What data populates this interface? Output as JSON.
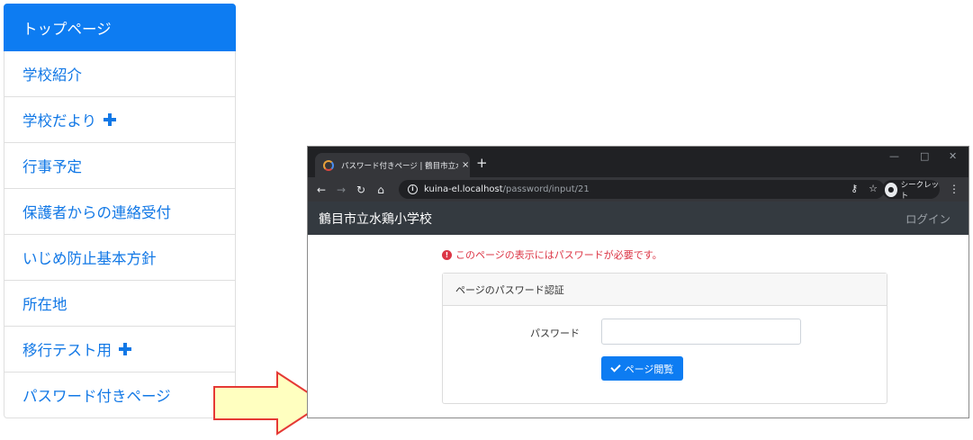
{
  "sidebar": {
    "items": [
      {
        "label": "トップページ",
        "active": true
      },
      {
        "label": "学校紹介"
      },
      {
        "label": "学校だより",
        "expandable": true
      },
      {
        "label": "行事予定"
      },
      {
        "label": "保護者からの連絡受付"
      },
      {
        "label": "いじめ防止基本方針"
      },
      {
        "label": "所在地"
      },
      {
        "label": "移行テスト用",
        "expandable": true
      },
      {
        "label": "パスワード付きページ"
      }
    ]
  },
  "browser": {
    "tab_title": "パスワード付きページ | 鶴目市立水鶏",
    "tab_close": "×",
    "new_tab": "+",
    "url_host": "kuina-el.localhost",
    "url_path": "/password/input/21",
    "incognito_label": "シークレット",
    "controls": {
      "minimize": "—",
      "maximize": "□",
      "close": "✕"
    }
  },
  "site": {
    "title": "鶴目市立水鶏小学校",
    "login": "ログイン",
    "alert": "このページの表示にはパスワードが必要です。",
    "card_header": "ページのパスワード認証",
    "password_label": "パスワード",
    "password_value": "",
    "submit_label": "ページ閲覧"
  },
  "colors": {
    "primary": "#0d7cf2",
    "link": "#1278e6",
    "danger": "#dc3545",
    "navbar": "#343a40",
    "arrow_fill": "#ffffc0",
    "arrow_stroke": "#e53935"
  }
}
